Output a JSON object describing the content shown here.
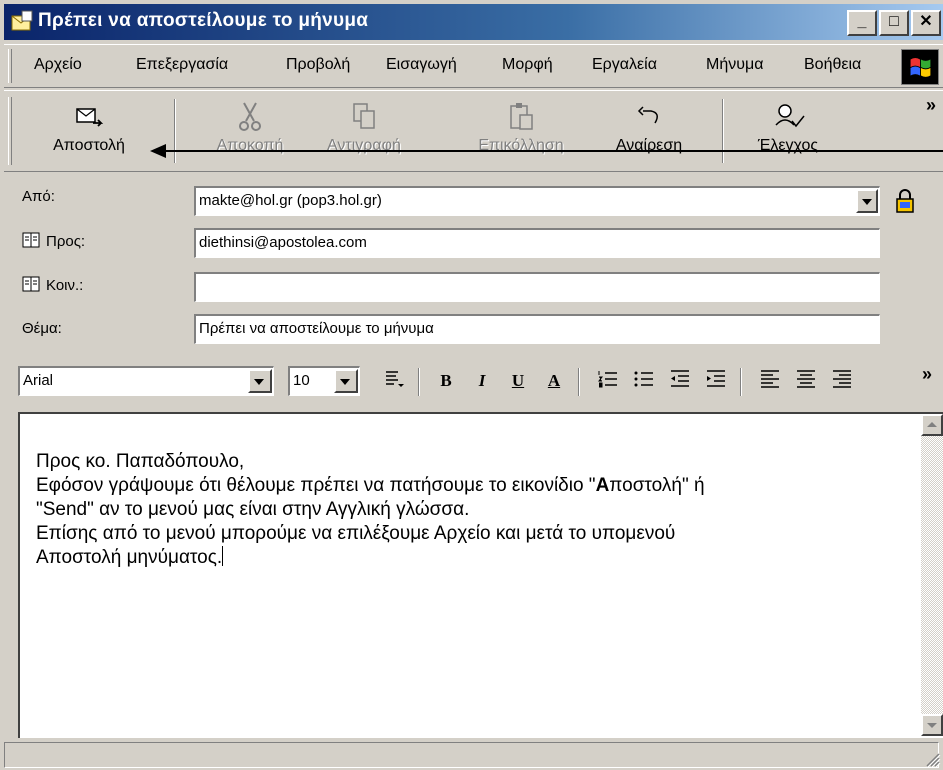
{
  "window": {
    "title": "Πρέπει να αποστείλουμε το μήνυμα",
    "controls": {
      "minimize": "_",
      "maximize": "□",
      "close": "✕"
    }
  },
  "menu": {
    "items": [
      {
        "label": "Αρχείο"
      },
      {
        "label": "Επεξεργασία"
      },
      {
        "label": "Προβολή"
      },
      {
        "label": "Εισαγωγή"
      },
      {
        "label": "Μορφή"
      },
      {
        "label": "Εργαλεία"
      },
      {
        "label": "Μήνυμα"
      },
      {
        "label": "Βοήθεια"
      }
    ]
  },
  "toolbar": {
    "send": "Αποστολή",
    "cut": "Αποκοπή",
    "copy": "Αντιγραφή",
    "paste": "Επικόλληση",
    "undo": "Αναίρεση",
    "check": "Έλεγχος",
    "more": "»"
  },
  "header": {
    "from_label": "Από:",
    "from_value": "makte@hol.gr    (pop3.hol.gr)",
    "to_label": "Προς:",
    "to_value": "diethinsi@apostolea.com",
    "cc_label": "Κοιν.:",
    "cc_value": "",
    "subject_label": "Θέμα:",
    "subject_value": "Πρέπει να αποστείλουμε το μήνυμα"
  },
  "format": {
    "font": "Arial",
    "size": "10",
    "bold": "B",
    "italic": "I",
    "underline": "U",
    "font_color": "A",
    "more": "»"
  },
  "body": {
    "line1": "Προς κο. Παπαδόπουλο,",
    "line2_a": "Εφόσον γράψουμε ότι θέλουμε πρέπει να πατήσουμε το εικονίδιο \"",
    "line2_bold": "Α",
    "line2_b": "ποστολή\" ή",
    "line3": "\"Send\" αν το μενού μας είναι στην Αγγλική γλώσσα.",
    "line4": "Επίσης από το μενού μπορούμε να επιλέξουμε Αρχείο και μετά το υπομενού",
    "line5": "Αποστολή μηνύματος."
  },
  "colors": {
    "title_start": "#0a246a",
    "title_end": "#a6caf0",
    "face": "#d4d0c8"
  }
}
